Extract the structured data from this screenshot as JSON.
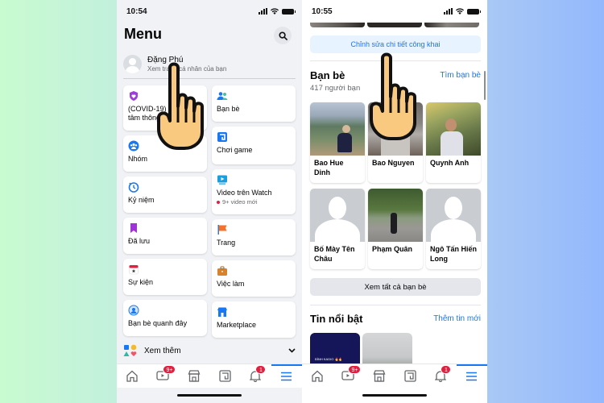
{
  "left_screen": {
    "status": {
      "time": "10:54"
    },
    "title": "Menu",
    "profile": {
      "name": "Đặng Phú",
      "subtitle": "Xem trang cá nhân của bạn"
    },
    "shortcuts_left": [
      {
        "label": "(COVID-19)",
        "label2": "tâm thông tin",
        "icon": "covid-heart-shield-icon",
        "color": "#9b3fd8"
      },
      {
        "label": "Nhóm",
        "icon": "groups-icon",
        "color": "#1877f2"
      },
      {
        "label": "Kỷ niệm",
        "icon": "memories-clock-icon",
        "color": "#1877f2"
      },
      {
        "label": "Đã lưu",
        "icon": "saved-bookmark-icon",
        "color": "#a033d8"
      },
      {
        "label": "Sự kiện",
        "icon": "events-calendar-icon",
        "color": "#e41e3f"
      },
      {
        "label": "Bạn bè quanh đây",
        "icon": "nearby-friends-icon",
        "color": "#1877f2"
      }
    ],
    "shortcuts_right": [
      {
        "label": "Bạn bè",
        "icon": "friends-icon",
        "color": "#1877f2"
      },
      {
        "label": "Chơi game",
        "icon": "gaming-icon",
        "color": "#1877f2"
      },
      {
        "label": "Video trên Watch",
        "sub": "9+ video mới",
        "icon": "watch-video-icon",
        "color": "#1b9ee0"
      },
      {
        "label": "Trang",
        "icon": "pages-flag-icon",
        "color": "#f3722c"
      },
      {
        "label": "Việc làm",
        "icon": "jobs-briefcase-icon",
        "color": "#d9822b"
      },
      {
        "label": "Marketplace",
        "icon": "marketplace-shop-icon",
        "color": "#1877f2"
      }
    ],
    "see_more": "Xem thêm"
  },
  "right_screen": {
    "status": {
      "time": "10:55"
    },
    "edit_public_details": "Chỉnh sửa chi tiết công khai",
    "friends": {
      "title": "Bạn bè",
      "find_link": "Tìm bạn bè",
      "count": "417 người bạn",
      "list": [
        {
          "name": "Bao Hue Dinh",
          "photo": "photo"
        },
        {
          "name": "Bao Nguyen",
          "photo": "photo"
        },
        {
          "name": "Quynh Anh",
          "photo": "photo"
        },
        {
          "name": "Bố Mày Tên Châu",
          "photo": "default"
        },
        {
          "name": "Phạm Quân",
          "photo": "photo"
        },
        {
          "name": "Ngô Tấn Hiến Long",
          "photo": "default"
        }
      ],
      "see_all": "Xem tất cả bạn bè"
    },
    "featured": {
      "title": "Tin nổi bật",
      "add_link": "Thêm tin mới",
      "story1_caption": "ĐÌNH KADIO 🔥🔥"
    }
  },
  "tabbar": {
    "tabs": [
      {
        "name": "home",
        "icon": "home-icon"
      },
      {
        "name": "watch",
        "icon": "watch-icon",
        "badge": "9+"
      },
      {
        "name": "marketplace",
        "icon": "marketplace-icon"
      },
      {
        "name": "gaming",
        "icon": "gaming-icon"
      },
      {
        "name": "notifications",
        "icon": "bell-icon",
        "badge": "1"
      },
      {
        "name": "menu",
        "icon": "menu-icon",
        "active": true
      }
    ]
  },
  "colors": {
    "accent": "#1877f2",
    "badge": "#e41e3f",
    "hand": "#f9c97f"
  }
}
